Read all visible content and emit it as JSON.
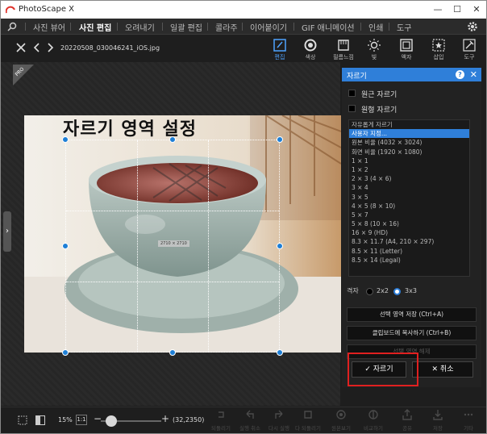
{
  "window": {
    "app_title": "PhotoScape X",
    "minimize_glyph": "—",
    "maximize_glyph": "☐",
    "close_glyph": "✕"
  },
  "menu": {
    "tabs": [
      "사진 뷰어",
      "사진 편집",
      "오려내기",
      "일괄 편집",
      "콜라주",
      "이어붙이기",
      "GIF 애니메이션",
      "인쇄",
      "도구"
    ],
    "active_tab": "사진 편집"
  },
  "toolbar": {
    "filename": "20220508_030046241_iOS.jpg",
    "tools": [
      {
        "label": "편집",
        "icon": "edit-icon"
      },
      {
        "label": "색상",
        "icon": "color-icon"
      },
      {
        "label": "필름느낌",
        "icon": "film-icon"
      },
      {
        "label": "빛",
        "icon": "light-icon"
      },
      {
        "label": "액자",
        "icon": "frame-icon"
      },
      {
        "label": "삽입",
        "icon": "insert-icon"
      },
      {
        "label": "도구",
        "icon": "tools-icon"
      }
    ]
  },
  "canvas": {
    "overlay_title": "자르기 영역 설정",
    "dimension_label": "2710 × 2710",
    "pro_badge": "PRO"
  },
  "crop_panel": {
    "title": "자르기",
    "help_glyph": "?",
    "close_glyph": "✕",
    "circle_crop_label": "원근 자르기",
    "round_crop_label": "원형 자르기",
    "ratio_options": [
      "자유롭게 자르기",
      "사용자 지정...",
      "원본 비율 (4032 × 3024)",
      "화면 비율 (1920 × 1080)",
      "1 × 1",
      "1 × 2",
      "2 × 3 (4 × 6)",
      "3 × 4",
      "3 × 5",
      "4 × 5 (8 × 10)",
      "5 × 7",
      "5 × 8 (10 × 16)",
      "16 × 9 (HD)",
      "8.3 × 11.7 (A4, 210 × 297)",
      "8.5 × 11 (Letter)",
      "8.5 × 14 (Legal)"
    ],
    "selected_option": "사용자 지정...",
    "grid_label": "격자",
    "grid_options": [
      "2x2",
      "3x3"
    ],
    "grid_selected": "3x3",
    "save_area_button": "선택 영역 저장 (Ctrl+A)",
    "copy_clipboard_button": "클립보드에 복사하기 (Ctrl+B)",
    "disabled_button": "선택 영역 해제",
    "ok_button": "자르기",
    "cancel_button": "취소",
    "ok_glyph": "✓",
    "cancel_glyph": "✕"
  },
  "bottombar": {
    "zoom": "15%",
    "one_to_one": "1:1",
    "minus": "−",
    "plus": "+",
    "coords": "(32,2350)",
    "tools": [
      "되돌리기",
      "실행 취소",
      "다시 실행",
      "다 되돌리기",
      "원본보기",
      "비교하기",
      "공유",
      "저장",
      "기타"
    ]
  }
}
